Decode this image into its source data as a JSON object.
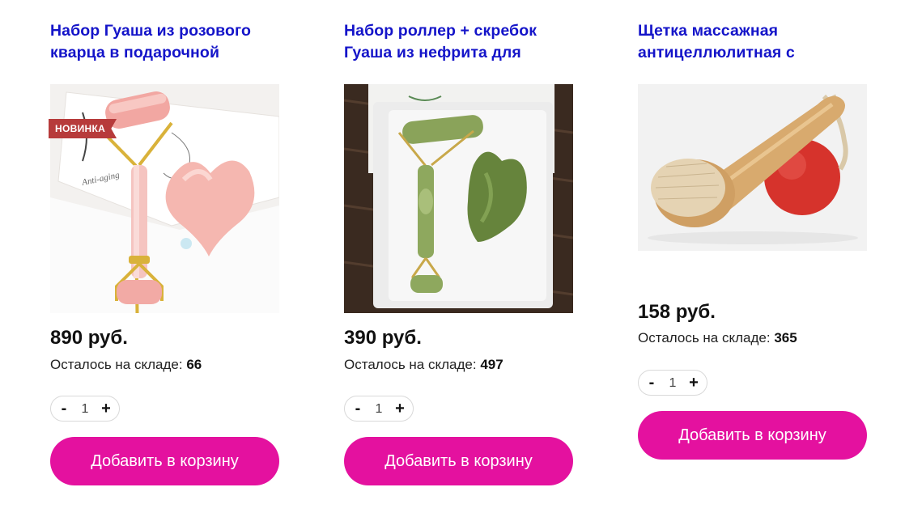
{
  "products": [
    {
      "title": "Набор Гуаша из розового кварца в подарочной",
      "badge": "НОВИНКА",
      "price": "890 руб.",
      "stock_label": "Осталось на складе:",
      "stock_value": "66",
      "quantity": "1",
      "minus": "-",
      "plus": "+",
      "button_label": "Добавить в корзину",
      "image_icon": "rose-quartz-roller-gua-sha-photo"
    },
    {
      "title": "Набор роллер + скребок Гуаша из нефрита для",
      "price": "390 руб.",
      "stock_label": "Осталось на складе:",
      "stock_value": "497",
      "quantity": "1",
      "minus": "-",
      "plus": "+",
      "button_label": "Добавить в корзину",
      "image_icon": "jade-roller-gua-sha-photo"
    },
    {
      "title": "Щетка массажная антицеллюлитная с",
      "price": "158 руб.",
      "stock_label": "Осталось на складе:",
      "stock_value": "365",
      "quantity": "1",
      "minus": "-",
      "plus": "+",
      "button_label": "Добавить в корзину",
      "image_icon": "wooden-massage-brush-photo"
    }
  ],
  "colors": {
    "title_link": "#1414c9",
    "button_bg": "#e4119f",
    "button_text": "#ffffff",
    "badge_bg": "#b73b3b"
  }
}
